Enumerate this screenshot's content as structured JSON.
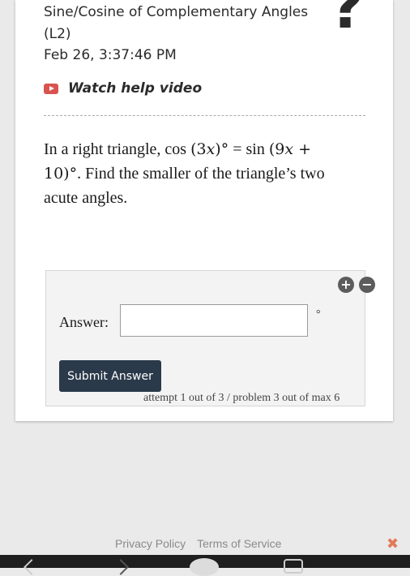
{
  "header": {
    "title": "Sine/Cosine of Complementary Angles (L2)",
    "timestamp": "Feb 26, 3:37:46 PM",
    "help_icon": "question-mark-icon",
    "help_symbol": "?",
    "help_video_label": "Watch help video"
  },
  "question": {
    "part1": "In a right triangle, cos ",
    "math1_open": "(3",
    "math1_var": "x",
    "math1_close": ")°",
    "part2": " = sin ",
    "math2_open": "(9",
    "math2_var": "x",
    "math2_close": " + 10)°",
    "part3": ". Find the smaller of the triangle’s two acute angles."
  },
  "answer": {
    "plus_symbol": "+",
    "minus_symbol": "−",
    "label": "Answer:",
    "input_value": "",
    "unit": "°",
    "submit_label": "Submit Answer",
    "attempt_text": "attempt 1 out of 3 / problem 3 out of max 6"
  },
  "footer": {
    "privacy": "Privacy Policy",
    "terms": "Terms of Service",
    "close_symbol": "✖"
  },
  "colors": {
    "submit_bg": "#2b3a4a",
    "video_icon": "#d9534f",
    "close": "#e27a5a"
  }
}
